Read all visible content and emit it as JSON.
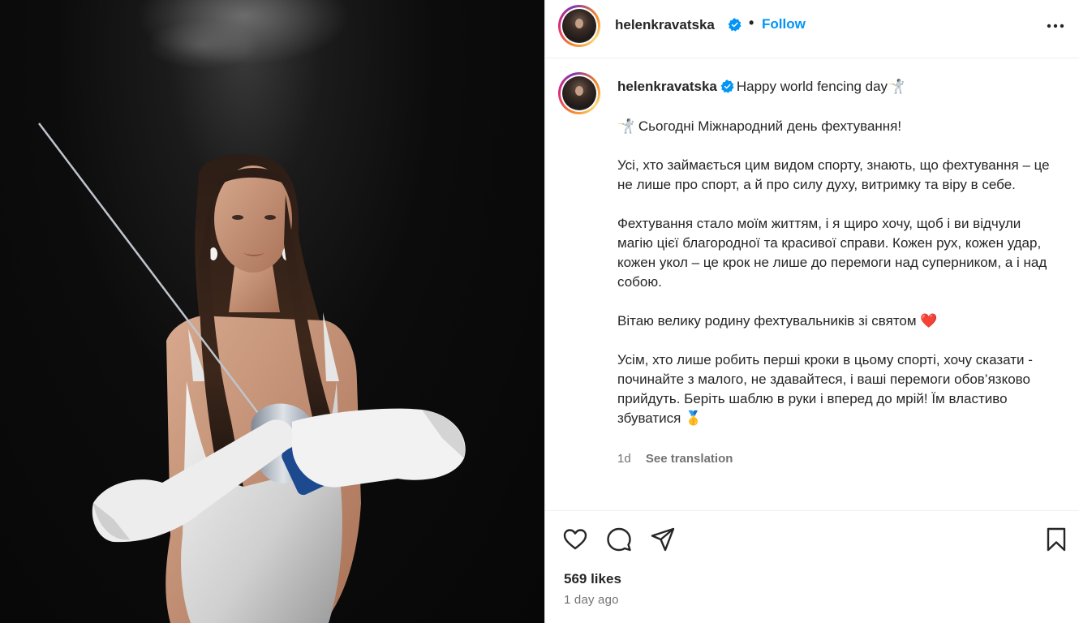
{
  "post": {
    "username": "helenkravatska",
    "follow_label": "Follow",
    "header_separator": "•",
    "caption_first_line": "Happy world fencing day🤺",
    "caption_paragraphs": [
      "🤺 Сьогодні Міжнародний день фехтування!",
      "Усі, хто займається цим видом спорту, знають, що фехтування – це не лише про спорт, а й про силу духу, витримку та віру в себе.",
      "Фехтування стало моїм життям, і я щиро хочу, щоб і ви відчули магію цієї благородної та красивої справи. Кожен рух, кожен удар, кожен укол – це крок не лише до перемоги над суперником, а і над собою.",
      "Вітаю велику родину фехтувальників зі святом ❤️",
      "Усім, хто лише робить перші кроки в цьому спорті, хочу сказати - починайте з малого, не здавайтеся, і ваші перемоги обов’язково прийдуть. Беріть шаблю в руки і вперед до мрій! Їм властиво збуватися 🥇"
    ],
    "caption_age": "1d",
    "see_translation_label": "See translation",
    "likes_text": "569 likes",
    "posted_ago": "1 day ago"
  },
  "colors": {
    "link_blue": "#0095f6",
    "verified_blue": "#0095f6",
    "muted": "#737373",
    "text": "#262626"
  },
  "icons": [
    "verified-badge-icon",
    "more-options-icon",
    "heart-icon",
    "comment-icon",
    "share-icon",
    "bookmark-icon"
  ]
}
